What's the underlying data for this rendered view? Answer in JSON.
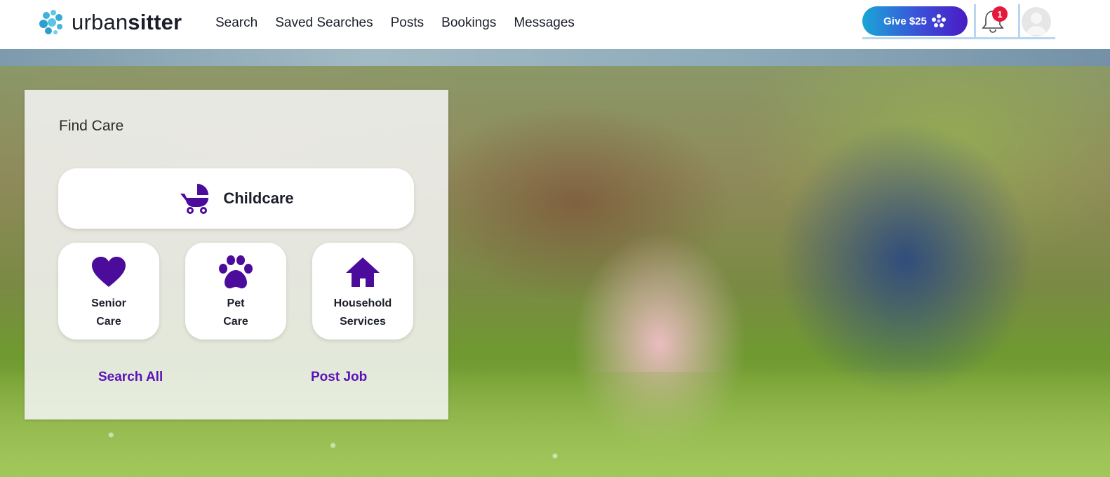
{
  "header": {
    "brand_prefix": "urban",
    "brand_suffix": "sitter",
    "nav": [
      "Search",
      "Saved Searches",
      "Posts",
      "Bookings",
      "Messages"
    ],
    "give_label": "Give $25",
    "notification_count": "1",
    "accent_color": "#4a1bc4"
  },
  "find_care": {
    "title": "Find Care",
    "childcare": "Childcare",
    "senior_line1": "Senior",
    "senior_line2": "Care",
    "pet_line1": "Pet",
    "pet_line2": "Care",
    "household_line1": "Household",
    "household_line2": "Services",
    "search_all": "Search All",
    "post_job": "Post Job",
    "icon_color": "#4b0c9c"
  },
  "icons": {
    "childcare": "stroller-icon",
    "senior": "heart-icon",
    "pet": "paw-icon",
    "household": "home-icon"
  }
}
